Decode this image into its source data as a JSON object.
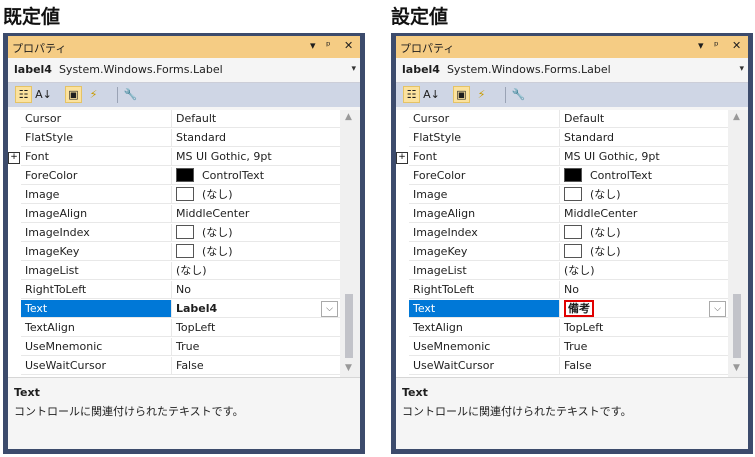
{
  "headings": {
    "left": "既定値",
    "right": "設定値"
  },
  "window": {
    "title": "プロパティ",
    "pin": "▾",
    "autohide": "ᵖ",
    "close": "✕"
  },
  "selector": {
    "name": "label4",
    "type": "System.Windows.Forms.Label",
    "arrow": "▾"
  },
  "toolbar": {
    "categorized": "☷",
    "alpha": "A↓",
    "properties": "▣",
    "events": "⚡",
    "pages": "🔧"
  },
  "expander": "+",
  "dropdown": "⌵",
  "scroll": {
    "up": "▲",
    "down": "▼"
  },
  "description": {
    "title": "Text",
    "text": "コントロールに関連付けられたテキストです。"
  },
  "colors": {
    "selection": "#0078d7",
    "titlebar": "#f5cc84",
    "highlight_box": "#e00000"
  },
  "left_rows": [
    {
      "name": "Cursor",
      "value": "Default"
    },
    {
      "name": "FlatStyle",
      "value": "Standard"
    },
    {
      "name": "Font",
      "value": "MS UI Gothic, 9pt"
    },
    {
      "name": "ForeColor",
      "value": "ControlText"
    },
    {
      "name": "Image",
      "value": "(なし)"
    },
    {
      "name": "ImageAlign",
      "value": "MiddleCenter"
    },
    {
      "name": "ImageIndex",
      "value": "(なし)"
    },
    {
      "name": "ImageKey",
      "value": "(なし)"
    },
    {
      "name": "ImageList",
      "value": "(なし)"
    },
    {
      "name": "RightToLeft",
      "value": "No"
    },
    {
      "name": "Text",
      "value": "Label4"
    },
    {
      "name": "TextAlign",
      "value": "TopLeft"
    },
    {
      "name": "UseMnemonic",
      "value": "True"
    },
    {
      "name": "UseWaitCursor",
      "value": "False"
    }
  ],
  "right_rows": [
    {
      "name": "Cursor",
      "value": "Default"
    },
    {
      "name": "FlatStyle",
      "value": "Standard"
    },
    {
      "name": "Font",
      "value": "MS UI Gothic, 9pt"
    },
    {
      "name": "ForeColor",
      "value": "ControlText"
    },
    {
      "name": "Image",
      "value": "(なし)"
    },
    {
      "name": "ImageAlign",
      "value": "MiddleCenter"
    },
    {
      "name": "ImageIndex",
      "value": "(なし)"
    },
    {
      "name": "ImageKey",
      "value": "(なし)"
    },
    {
      "name": "ImageList",
      "value": "(なし)"
    },
    {
      "name": "RightToLeft",
      "value": "No"
    },
    {
      "name": "Text",
      "value": "備考"
    },
    {
      "name": "TextAlign",
      "value": "TopLeft"
    },
    {
      "name": "UseMnemonic",
      "value": "True"
    },
    {
      "name": "UseWaitCursor",
      "value": "False"
    }
  ]
}
